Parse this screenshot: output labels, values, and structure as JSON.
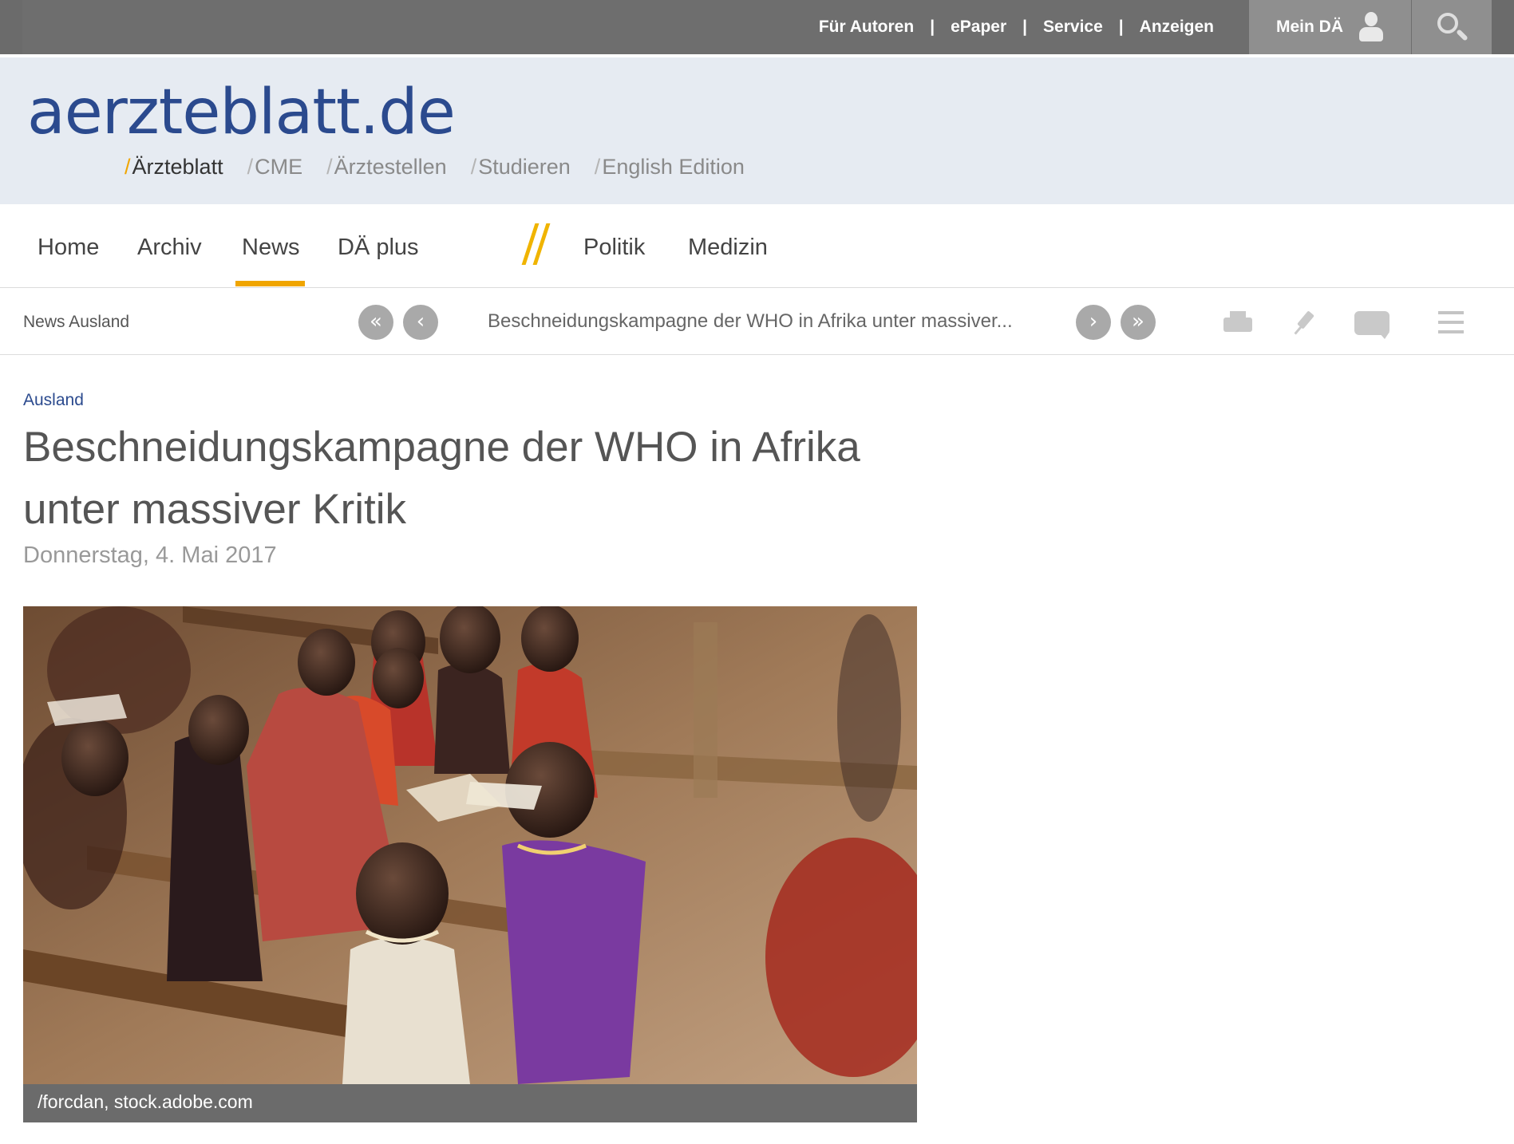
{
  "topbar": {
    "links": [
      "Für Autoren",
      "ePaper",
      "Service",
      "Anzeigen"
    ],
    "separator": "|",
    "account_label": "Mein DÄ",
    "icons": {
      "account": "user-icon",
      "search": "search-icon"
    }
  },
  "masthead": {
    "logo": "aerzteblatt.de",
    "portals": [
      {
        "label": "Ärzteblatt",
        "active": true
      },
      {
        "label": "CME",
        "active": false
      },
      {
        "label": "Ärztestellen",
        "active": false
      },
      {
        "label": "Studieren",
        "active": false
      },
      {
        "label": "English Edition",
        "active": false
      }
    ],
    "portal_slash": "/"
  },
  "mainnav": {
    "items": [
      "Home",
      "Archiv",
      "News",
      "DÄ plus",
      "Politik",
      "Medizin"
    ],
    "active": "News",
    "accent_color": "#f0a500"
  },
  "toolbar": {
    "section": "News Ausland",
    "teaser": "Beschneidungskampagne der WHO in Afrika unter massiver...",
    "nav_glyphs": {
      "first": "«",
      "prev": "‹",
      "next": "›",
      "last": "»"
    },
    "tools": [
      "printer-icon",
      "pin-icon",
      "comment-icon",
      "menu-icon"
    ]
  },
  "article": {
    "rubric": "Ausland",
    "headline": "Beschneidungskampagne der WHO in Afrika unter massiver Kritik",
    "date": "Donnerstag, 4. Mai 2017",
    "image_caption": "/forcdan, stock.adobe.com"
  },
  "colors": {
    "brand_blue": "#2b4a8e",
    "accent_orange": "#f0a500",
    "topbar_gray": "#6b6b6b",
    "masthead_bg": "#e6ebf2"
  }
}
